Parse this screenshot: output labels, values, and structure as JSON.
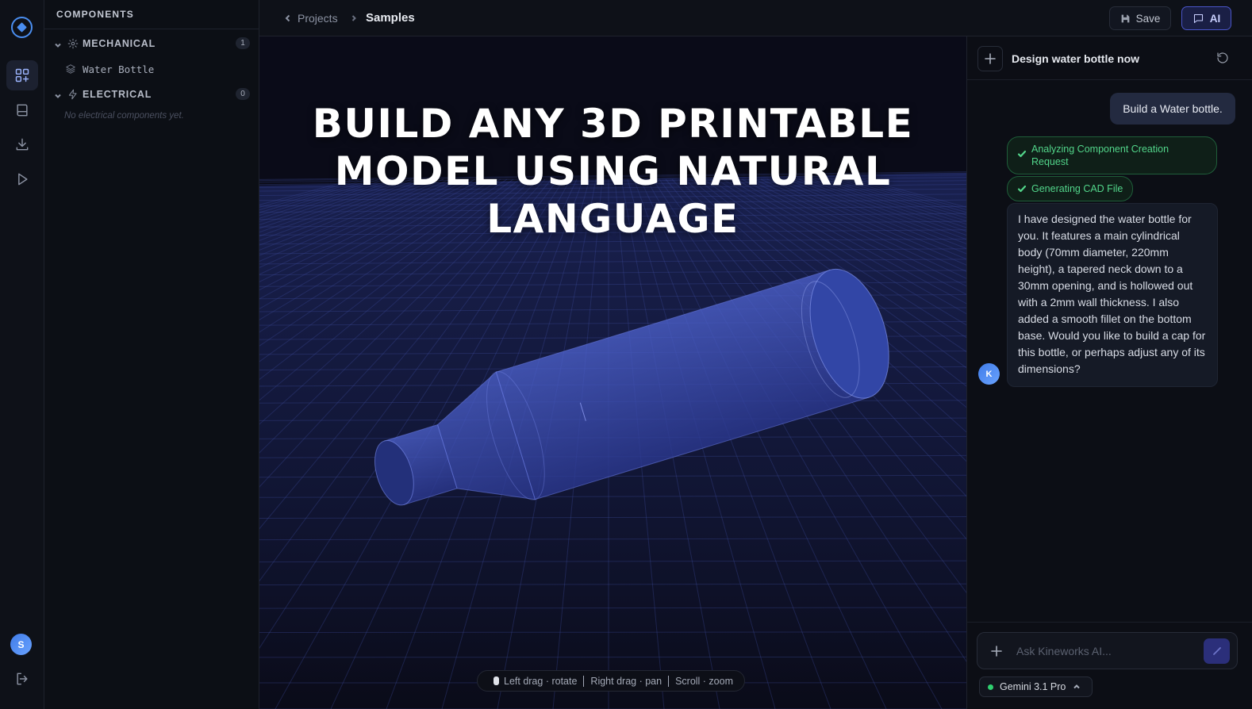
{
  "rail": {
    "items": [
      {
        "name": "components",
        "icon": "grid-plus-icon",
        "active": true
      },
      {
        "name": "library",
        "icon": "book-icon",
        "active": false
      },
      {
        "name": "export",
        "icon": "download-icon",
        "active": false
      },
      {
        "name": "simulate",
        "icon": "play-icon",
        "active": false
      }
    ],
    "user_initial": "S"
  },
  "components_panel": {
    "title": "COMPONENTS",
    "groups": [
      {
        "name": "MECHANICAL",
        "icon": "gear-icon",
        "count": "1",
        "items": [
          {
            "label": "Water Bottle",
            "icon": "layers-icon"
          }
        ]
      },
      {
        "name": "ELECTRICAL",
        "icon": "bolt-icon",
        "count": "0",
        "empty_text": "No electrical components yet."
      }
    ]
  },
  "topbar": {
    "back_label": "Projects",
    "current": "Samples",
    "save_label": "Save",
    "ai_label": "AI"
  },
  "viewport": {
    "headline": "BUILD ANY 3D PRINTABLE MODEL USING NATURAL LANGUAGE",
    "hints": [
      "Left drag · rotate",
      "Right drag · pan",
      "Scroll · zoom"
    ]
  },
  "chat": {
    "title": "Design water bottle now",
    "user_message": "Build a Water bottle.",
    "statuses": [
      "Analyzing Component Creation Request",
      "Generating CAD File"
    ],
    "assistant_message": "I have designed the water bottle for you. It features a main cylindrical body (70mm diameter, 220mm height), a tapered neck down to a 30mm opening, and is hollowed out with a 2mm wall thickness. I also added a smooth fillet on the bottom base. Would you like to build a cap for this bottle, or perhaps adjust any of its dimensions?",
    "assistant_initial": "K",
    "composer_placeholder": "Ask Kineworks AI...",
    "model_label": "Gemini 3.1 Pro"
  },
  "colors": {
    "accent": "#4a8ef0",
    "ai_button": "#1a1f45",
    "status_green": "#52d58a",
    "model_dot": "#2fcf6f",
    "bottle": "#3a4fb0"
  }
}
